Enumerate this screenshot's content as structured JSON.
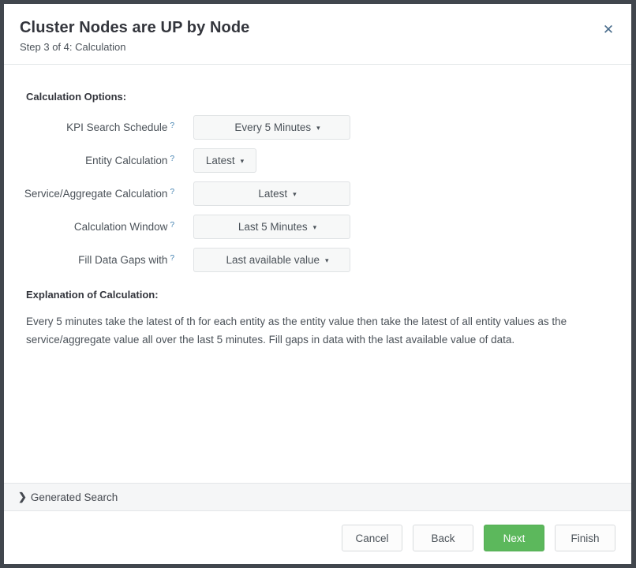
{
  "dialog": {
    "title": "Cluster Nodes are UP by Node",
    "subtitle": "Step 3 of 4: Calculation",
    "close_icon": "close-icon",
    "close_glyph": "✕"
  },
  "body": {
    "options_heading": "Calculation Options:",
    "help_marker": "?",
    "caret_glyph": "▾",
    "fields": [
      {
        "label": "KPI Search Schedule",
        "value": "Every 5 Minutes",
        "width": "wide"
      },
      {
        "label": "Entity Calculation",
        "value": "Latest",
        "width": "narrow"
      },
      {
        "label": "Service/Aggregate Calculation",
        "value": "Latest",
        "width": "wide"
      },
      {
        "label": "Calculation Window",
        "value": "Last 5 Minutes",
        "width": "wide"
      },
      {
        "label": "Fill Data Gaps with",
        "value": "Last available value",
        "width": "wide"
      }
    ],
    "explanation_heading": "Explanation of Calculation:",
    "explanation_text": "Every 5 minutes take the latest of th for each entity as the entity value then take the latest of all entity values as the service/aggregate value all over the last 5 minutes. Fill gaps in data with the last available value of data."
  },
  "generated_search": {
    "label": "Generated Search",
    "chevron_glyph": "❯"
  },
  "footer": {
    "cancel_label": "Cancel",
    "back_label": "Back",
    "next_label": "Next",
    "finish_label": "Finish"
  },
  "colors": {
    "primary_green": "#5cb85c",
    "frame_dark": "#41464d",
    "help_blue": "#3f7faf",
    "text_dark": "#33353c"
  }
}
